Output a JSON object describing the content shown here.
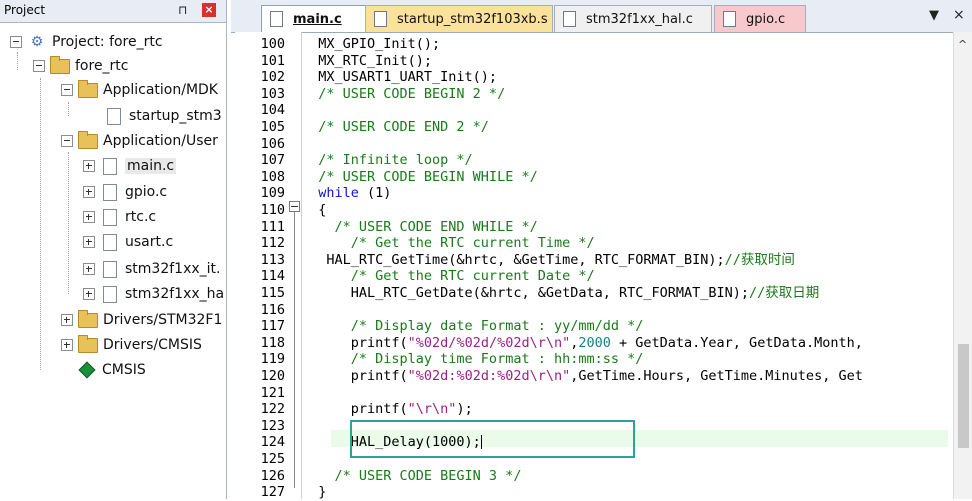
{
  "project": {
    "title": "Project",
    "pin_icon": "pin-icon",
    "close_icon": "close-icon",
    "tree": [
      {
        "label": "Project: fore_rtc",
        "icon": "project-icon"
      },
      {
        "label": "fore_rtc",
        "icon": "folder-icon"
      },
      {
        "label": "Application/MDK",
        "icon": "folder-icon"
      },
      {
        "label": "startup_stm3",
        "icon": "file-icon"
      },
      {
        "label": "Application/User",
        "icon": "folder-icon"
      },
      {
        "label": "main.c",
        "icon": "file-icon"
      },
      {
        "label": "gpio.c",
        "icon": "file-icon"
      },
      {
        "label": "rtc.c",
        "icon": "file-icon"
      },
      {
        "label": "usart.c",
        "icon": "file-icon"
      },
      {
        "label": "stm32f1xx_it.",
        "icon": "file-icon"
      },
      {
        "label": "stm32f1xx_ha",
        "icon": "file-icon"
      },
      {
        "label": "Drivers/STM32F1",
        "icon": "folder-icon"
      },
      {
        "label": "Drivers/CMSIS",
        "icon": "folder-icon"
      },
      {
        "label": "CMSIS",
        "icon": "gem-icon"
      }
    ]
  },
  "tabs": [
    {
      "label": "main.c"
    },
    {
      "label": "startup_stm32f103xb.s"
    },
    {
      "label": "stm32f1xx_hal.c"
    },
    {
      "label": "gpio.c"
    }
  ],
  "tab_controls": {
    "dropdown": "▼",
    "close": "×"
  },
  "editor": {
    "line_numbers": [
      "100",
      "101",
      "102",
      "103",
      "104",
      "105",
      "106",
      "107",
      "108",
      "109",
      "110",
      "111",
      "112",
      "113",
      "114",
      "115",
      "116",
      "117",
      "118",
      "119",
      "120",
      "121",
      "122",
      "123",
      "124",
      "125",
      "126",
      "127"
    ],
    "lines": [
      [
        {
          "t": "  MX_GPIO_Init();",
          "k": ""
        }
      ],
      [
        {
          "t": "  MX_RTC_Init();",
          "k": ""
        }
      ],
      [
        {
          "t": "  MX_USART1_UART_Init();",
          "k": ""
        }
      ],
      [
        {
          "t": "  /* USER CODE BEGIN 2 */",
          "k": "c"
        }
      ],
      [
        {
          "t": "",
          "k": ""
        }
      ],
      [
        {
          "t": "  /* USER CODE END 2 */",
          "k": "c"
        }
      ],
      [
        {
          "t": "",
          "k": ""
        }
      ],
      [
        {
          "t": "  /* Infinite loop */",
          "k": "c"
        }
      ],
      [
        {
          "t": "  /* USER CODE BEGIN WHILE */",
          "k": "c"
        }
      ],
      [
        {
          "t": "  ",
          "k": ""
        },
        {
          "t": "while",
          "k": "kw"
        },
        {
          "t": " (1)",
          "k": ""
        }
      ],
      [
        {
          "t": "  {",
          "k": ""
        }
      ],
      [
        {
          "t": "    /* USER CODE END WHILE */",
          "k": "c"
        }
      ],
      [
        {
          "t": "      /* Get the RTC current Time */",
          "k": "c"
        }
      ],
      [
        {
          "t": "   HAL_RTC_GetTime(&hrtc, &GetTime, RTC_FORMAT_BIN);",
          "k": ""
        },
        {
          "t": "//获取时间",
          "k": "cn"
        }
      ],
      [
        {
          "t": "      /* Get the RTC current Date */",
          "k": "c"
        }
      ],
      [
        {
          "t": "      HAL_RTC_GetDate(&hrtc, &GetData, RTC_FORMAT_BIN);",
          "k": ""
        },
        {
          "t": "//获取日期",
          "k": "cn"
        }
      ],
      [
        {
          "t": "",
          "k": ""
        }
      ],
      [
        {
          "t": "      /* Display date Format : yy/mm/dd */",
          "k": "c"
        }
      ],
      [
        {
          "t": "      printf(",
          "k": ""
        },
        {
          "t": "\"%02d/%02d/%02d\\r\\n\"",
          "k": "s"
        },
        {
          "t": ",",
          "k": ""
        },
        {
          "t": "2000",
          "k": "n"
        },
        {
          "t": " + GetData.Year, GetData.Month,",
          "k": ""
        }
      ],
      [
        {
          "t": "      /* Display time Format : hh:mm:ss */",
          "k": "c"
        }
      ],
      [
        {
          "t": "      printf(",
          "k": ""
        },
        {
          "t": "\"%02d:%02d:%02d\\r\\n\"",
          "k": "s"
        },
        {
          "t": ",GetTime.Hours, GetTime.Minutes, Get",
          "k": ""
        }
      ],
      [
        {
          "t": "",
          "k": ""
        }
      ],
      [
        {
          "t": "      printf(",
          "k": ""
        },
        {
          "t": "\"\\r\\n\"",
          "k": "s"
        },
        {
          "t": ");",
          "k": ""
        }
      ],
      [
        {
          "t": "",
          "k": ""
        }
      ],
      [
        {
          "t": "      HAL_Delay(1000);",
          "k": ""
        }
      ],
      [
        {
          "t": "",
          "k": ""
        }
      ],
      [
        {
          "t": "    /* USER CODE BEGIN 3 */",
          "k": "c"
        }
      ],
      [
        {
          "t": "  }",
          "k": ""
        }
      ]
    ]
  }
}
